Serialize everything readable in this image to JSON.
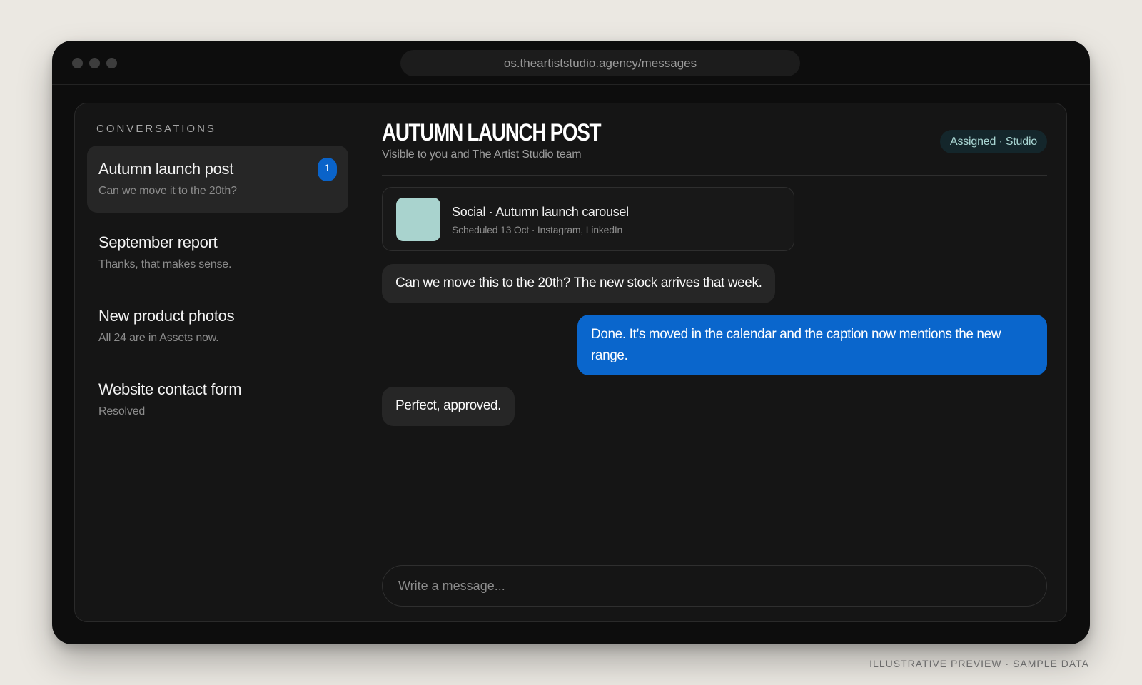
{
  "browser": {
    "url": "os.theartiststudio.agency/messages"
  },
  "sidebar": {
    "title": "CONVERSATIONS",
    "items": [
      {
        "name": "Autumn launch post",
        "preview": "Can we move it to the 20th?",
        "badge": "1"
      },
      {
        "name": "September report",
        "preview": "Thanks, that makes sense."
      },
      {
        "name": "New product photos",
        "preview": "All 24 are in Assets now."
      },
      {
        "name": "Website contact form",
        "preview": "Resolved"
      }
    ]
  },
  "chat": {
    "title": "AUTUMN LAUNCH POST",
    "subtitle": "Visible to you and The Artist Studio team",
    "assigned": "Assigned · Studio",
    "attachment": {
      "title": "Social · Autumn launch carousel",
      "meta": "Scheduled 13 Oct · Instagram, LinkedIn",
      "color": "#a9d3ce"
    },
    "messages": [
      {
        "from": "client",
        "text": "Can we move this to the 20th? The new stock arrives that week."
      },
      {
        "from": "studio",
        "text": "Done. It’s moved in the calendar and the caption now mentions the new range."
      },
      {
        "from": "client",
        "text": "Perfect, approved."
      }
    ],
    "composer_placeholder": "Write a message..."
  },
  "footer": {
    "note": "ILLUSTRATIVE PREVIEW · SAMPLE DATA"
  },
  "colors": {
    "accent": "#0a66cc",
    "background": "#ebe8e2",
    "window": "#0d0d0d"
  }
}
